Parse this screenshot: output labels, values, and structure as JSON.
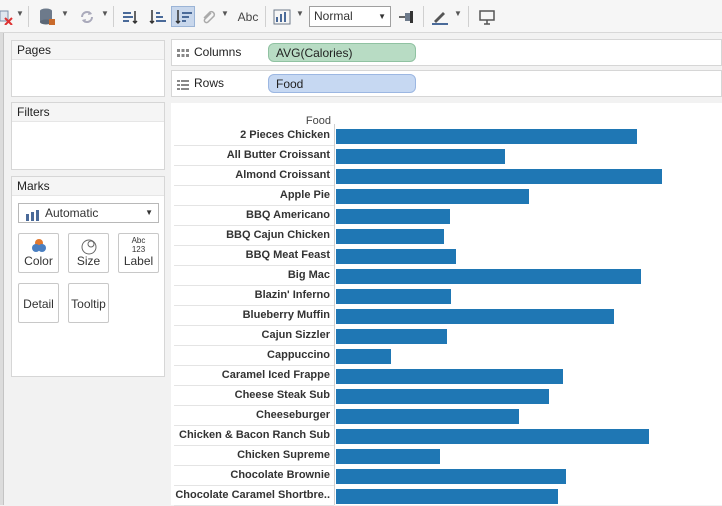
{
  "toolbar": {
    "fit_value": "Normal",
    "label_button": "Abc"
  },
  "cards": {
    "pages_title": "Pages",
    "filters_title": "Filters",
    "marks_title": "Marks",
    "mark_type": "Automatic",
    "mark_buttons": {
      "color": "Color",
      "size": "Size",
      "label": "Label",
      "label_icon_top": "Abc",
      "label_icon_bottom": "123",
      "detail": "Detail",
      "tooltip": "Tooltip"
    }
  },
  "shelves": {
    "columns_label": "Columns",
    "columns_pill": "AVG(Calories)",
    "rows_label": "Rows",
    "rows_pill": "Food"
  },
  "chart_data": {
    "type": "bar",
    "orientation": "horizontal",
    "row_header": "Food",
    "measure": "AVG(Calories)",
    "bar_color": "#1f77b4",
    "categories": [
      "2 Pieces Chicken",
      "All Butter Croissant",
      "Almond Croissant",
      "Apple Pie",
      "BBQ Americano",
      "BBQ Cajun Chicken",
      "BBQ Meat Feast",
      "Big Mac",
      "Blazin' Inferno",
      "Blueberry Muffin",
      "Cajun Sizzler",
      "Cappuccino",
      "Caramel Iced Frappe",
      "Cheese Steak Sub",
      "Cheeseburger",
      "Chicken & Bacon Ranch Sub",
      "Chicken Supreme",
      "Chocolate Brownie",
      "Chocolate Caramel Shortbre.."
    ],
    "values": [
      300,
      168,
      325,
      192,
      114,
      108,
      120,
      304,
      115,
      277,
      111,
      55,
      226,
      212,
      182,
      312,
      104,
      229,
      221
    ],
    "xlim": [
      0,
      325
    ]
  }
}
